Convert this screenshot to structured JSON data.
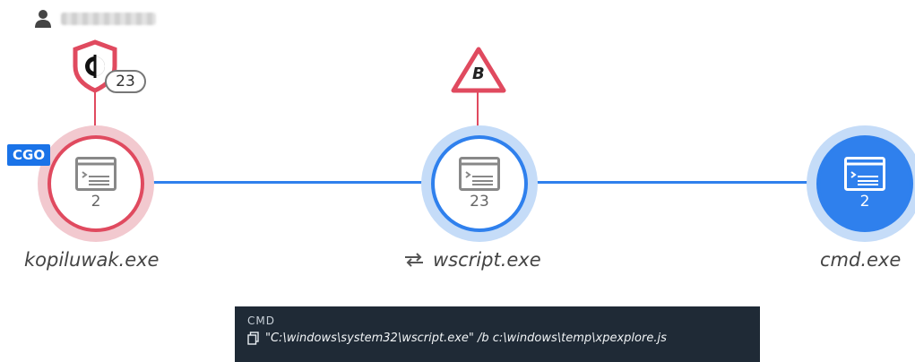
{
  "user": {
    "icon": "user-icon",
    "name_redacted": true
  },
  "alerts": {
    "process_one_alert_count": "23",
    "process_two_badge_letter": "B"
  },
  "badge": {
    "label": "CGO"
  },
  "nodes": [
    {
      "name": "kopiluwak.exe",
      "count": "2",
      "state": "alert",
      "color": "#e04a5f"
    },
    {
      "name": "wscript.exe",
      "count": "23",
      "state": "normal",
      "color": "#2f80ed"
    },
    {
      "name": "cmd.exe",
      "count": "2",
      "state": "selected",
      "color": "#2f80ed"
    }
  ],
  "cmd_panel": {
    "title": "CMD",
    "command": "\"C:\\windows\\system32\\wscript.exe\" /b c:\\windows\\temp\\xpexplore.js"
  },
  "colors": {
    "accent": "#2f80ed",
    "alert": "#e04a5f",
    "panel_bg": "#1f2a36"
  }
}
